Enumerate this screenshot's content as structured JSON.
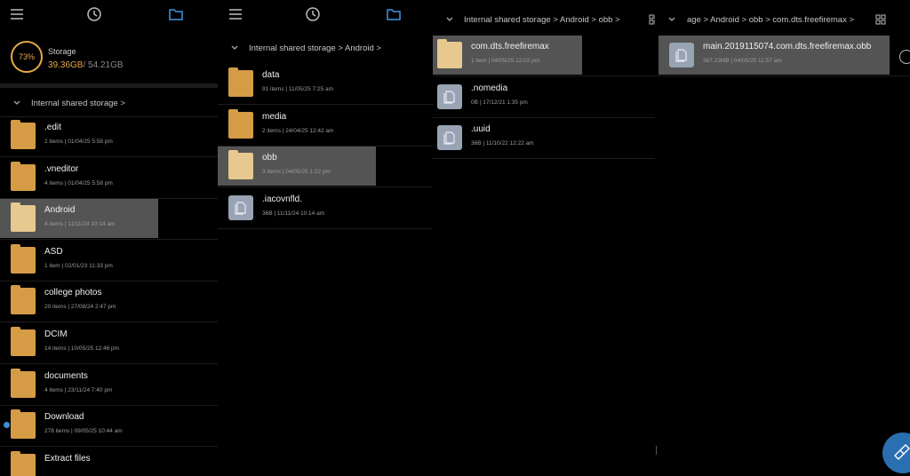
{
  "colors": {
    "accent": "#e8a84a",
    "folder": "#d59c45",
    "selected_bg": "#545454",
    "fab": "#2a6fb0"
  },
  "toolbar": {
    "icons": [
      "menu-icon",
      "clock-icon",
      "folder-icon"
    ]
  },
  "storage": {
    "percent": "73%",
    "label": "Storage",
    "used": "39.36GB",
    "total": "/ 54.21GB"
  },
  "pane1": {
    "breadcrumb": "Internal shared storage >",
    "items": [
      {
        "name": ".edit",
        "meta": "2 items  |  01/04/25 5:58 pm",
        "type": "folder"
      },
      {
        "name": ".vneditor",
        "meta": "4 items  |  01/04/25 5:58 pm",
        "type": "folder"
      },
      {
        "name": "Android",
        "meta": "4 items  |  11/11/24 10:14 am",
        "type": "folder",
        "selected": true
      },
      {
        "name": "ASD",
        "meta": "1 item  |  02/01/23 11:33 pm",
        "type": "folder"
      },
      {
        "name": "college photos",
        "meta": "20 items  |  27/08/24 2:47 pm",
        "type": "folder"
      },
      {
        "name": "DCIM",
        "meta": "14 items  |  10/05/25 12:46 pm",
        "type": "folder"
      },
      {
        "name": "documents",
        "meta": "4 items  |  23/11/24 7:40 pm",
        "type": "folder"
      },
      {
        "name": "Download",
        "meta": "278 items  |  09/05/25 10:44 am",
        "type": "folder"
      },
      {
        "name": "Extract files",
        "meta": "",
        "type": "folder"
      }
    ]
  },
  "pane2": {
    "breadcrumb": "Internal shared storage > Android >",
    "items": [
      {
        "name": "data",
        "meta": "91 items  |  11/05/25 7:25 am",
        "type": "folder"
      },
      {
        "name": "media",
        "meta": "2 items  |  24/04/25 12:42 am",
        "type": "folder"
      },
      {
        "name": "obb",
        "meta": "3 items  |  04/05/25 1:22 pm",
        "type": "folder",
        "selected": true
      },
      {
        "name": ".iacovnfld.",
        "meta": "36B  |  11/11/24 10:14 am",
        "type": "file"
      }
    ]
  },
  "pane3": {
    "breadcrumb": "Internal shared storage > Android > obb >",
    "items": [
      {
        "name": "com.dts.freefiremax",
        "meta": "1 item  |  04/05/25 12:02 pm",
        "type": "folder",
        "selected": true
      },
      {
        "name": ".nomedia",
        "meta": "0B  |  17/12/21 1:35 pm",
        "type": "file"
      },
      {
        "name": ".uuid",
        "meta": "36B  |  11/10/22 12:22 am",
        "type": "file"
      }
    ]
  },
  "pane4": {
    "breadcrumb": "age > Android > obb > com.dts.freefiremax >",
    "items": [
      {
        "name": "main.2019115074.com.dts.freefiremax.obb",
        "meta": "367.23MB  |  04/05/25 11:57 am",
        "type": "file",
        "selected": true
      }
    ]
  }
}
